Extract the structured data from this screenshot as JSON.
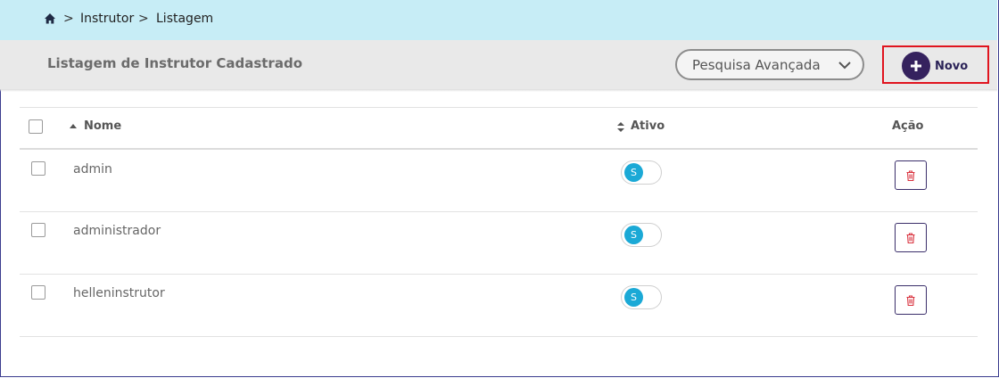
{
  "breadcrumb": {
    "home_icon": "home-icon",
    "separator": ">",
    "items": [
      "Instrutor",
      "Listagem"
    ]
  },
  "header": {
    "title": "Listagem de Instrutor Cadastrado",
    "advanced_search_label": "Pesquisa Avançada",
    "new_button_label": "Novo"
  },
  "table": {
    "columns": [
      "Nome",
      "Ativo",
      "Ação"
    ],
    "rows": [
      {
        "name": "admin",
        "active": "S"
      },
      {
        "name": "administrador",
        "active": "S"
      },
      {
        "name": "helleninstrutor",
        "active": "S"
      }
    ]
  },
  "colors": {
    "breadcrumb_bg": "#c7edf6",
    "header_bg": "#e9e9e9",
    "primary": "#35225e",
    "toggle_on": "#1ba9d6",
    "delete": "#d9333f",
    "highlight_border": "#e0141e"
  }
}
